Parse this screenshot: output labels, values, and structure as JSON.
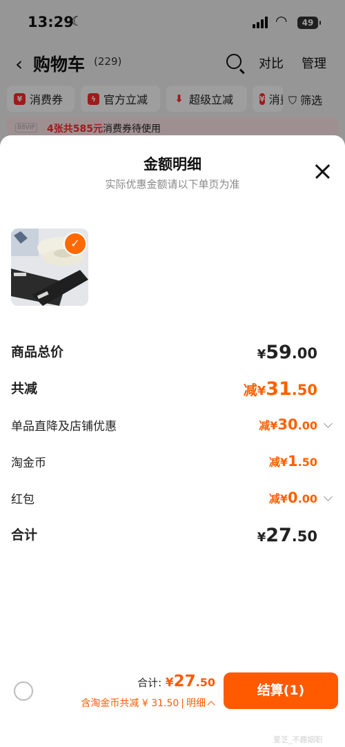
{
  "status_bar": {
    "time": "13:29",
    "battery": "49"
  },
  "header": {
    "back": "‹",
    "title": "购物车",
    "count": "(229)",
    "compare": "对比",
    "manage": "管理"
  },
  "filters": {
    "chip1": "消费券",
    "chip2": "官方立减",
    "chip3": "超级立减",
    "chip4": "消费",
    "filter": "筛选"
  },
  "vip_bar": {
    "tag": "88VIP",
    "highlight": "4张共585元",
    "text": "消费券待使用"
  },
  "sheet": {
    "title": "金额明细",
    "subtitle": "实际优惠金额请以下单页为准",
    "rows": {
      "subtotal": {
        "label": "商品总价",
        "symbol": "¥",
        "int": "59",
        "dec": ".00"
      },
      "discount": {
        "label": "共减",
        "prefix": "减",
        "symbol": "¥",
        "int": "31",
        "dec": ".50"
      },
      "shop": {
        "label": "单品直降及店铺优惠",
        "prefix": "减",
        "symbol": "¥",
        "int": "30",
        "dec": ".00"
      },
      "coin": {
        "label": "淘金币",
        "prefix": "减",
        "symbol": "¥",
        "int": "1",
        "dec": ".50"
      },
      "redpack": {
        "label": "红包",
        "prefix": "减",
        "symbol": "¥",
        "int": "0",
        "dec": ".00"
      },
      "total": {
        "label": "合计",
        "symbol": "¥",
        "int": "27",
        "dec": ".50"
      }
    }
  },
  "bottom": {
    "total_label": "合计:",
    "total_symbol": "¥",
    "total_int": "27",
    "total_dec": ".50",
    "coin_text": "含淘金币共减 ¥ 31.50",
    "sep": "|",
    "detail": "明细",
    "checkout": "结算(1)"
  },
  "watermark": "爱芝_不趣姻职"
}
